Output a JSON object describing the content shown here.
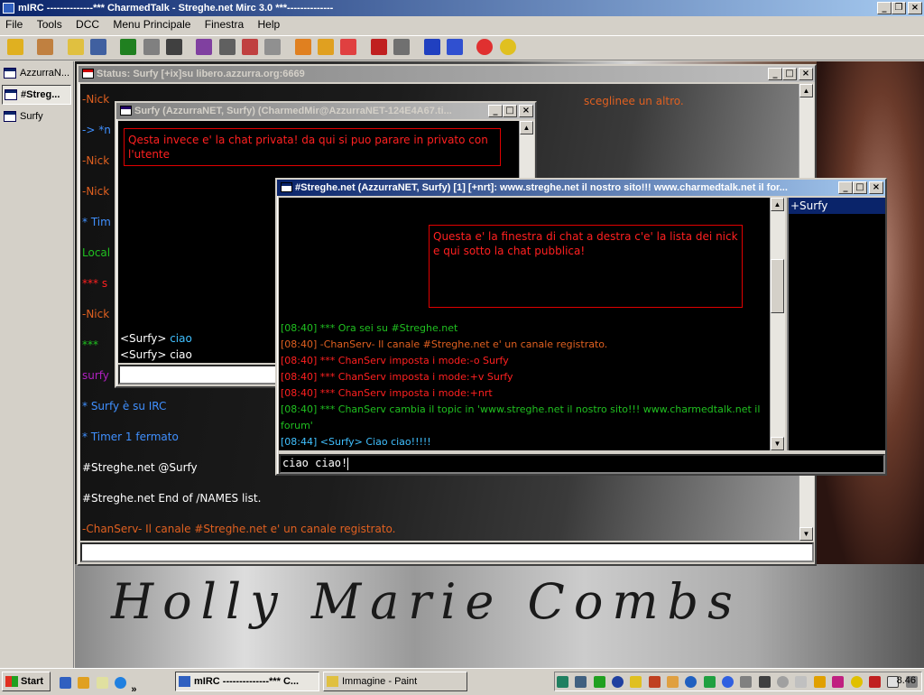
{
  "app": {
    "title": "mIRC --------------*** CharmedTalk - Streghe.net Mirc 3.0 ***--------------"
  },
  "menu": [
    "File",
    "Tools",
    "DCC",
    "Menu Principale",
    "Finestra",
    "Help"
  ],
  "switchbar": [
    {
      "label": "AzzurraN...",
      "active": false
    },
    {
      "label": "#Streg...",
      "active": true
    },
    {
      "label": "Surfy",
      "active": false
    }
  ],
  "status_window": {
    "title": "Status: Surfy [+ix]su libero.azzurra.org:6669",
    "lines": [
      {
        "text": "-Nick",
        "color": "#e06020"
      },
      {
        "text": "-> *n",
        "color": "#4090ff"
      },
      {
        "text": "-Nick",
        "color": "#e06020"
      },
      {
        "text": "-Nick",
        "color": "#e06020"
      },
      {
        "text": "* Tim",
        "color": "#4090ff"
      },
      {
        "text": "Local",
        "color": "#20c020"
      },
      {
        "text": "*** s",
        "color": "#ff2020"
      },
      {
        "text": "-Nick",
        "color": "#e06020"
      },
      {
        "text": "***",
        "color": "#20c020"
      },
      {
        "text": "surfy",
        "color": "#b020c0"
      },
      {
        "text": "* Surfy è su IRC",
        "color": "#4090ff"
      },
      {
        "text": "* Timer 1 fermato",
        "color": "#4090ff"
      },
      {
        "text": "#Streghe.net @Surfy",
        "color": "#ffffff"
      },
      {
        "text": "#Streghe.net End of /NAMES list.",
        "color": "#ffffff"
      },
      {
        "text": "-ChanServ- Il canale #Streghe.net e' un canale registrato.",
        "color": "#e06020"
      }
    ],
    "overflow_text": "-Nick ... sceglinee un altro."
  },
  "private_window": {
    "title": "Surfy (AzzurraNET, Surfy) (CharmedMir@AzzurraNET-124E4A67.ti...",
    "annotation": "Qesta invece e' la chat privata! da qui si puo parare in privato con l'utente",
    "lines": [
      {
        "nick": "<Surfy>",
        "msg": "ciao",
        "msgcolor": "#40c0ff"
      },
      {
        "nick": "<Surfy>",
        "msg": "ciao",
        "msgcolor": "#ffffff"
      }
    ]
  },
  "channel_window": {
    "title": "#Streghe.net (AzzurraNET, Surfy) [1] [+nrt]: www.streghe.net il nostro sito!!! www.charmedtalk.net il for...",
    "annotation": "Questa e' la finestra di chat a destra c'e' la lista dei nick e qui sotto la chat pubblica!",
    "lines": [
      {
        "text": "[08:40] *** Ora sei su #Streghe.net",
        "color": "#20c020"
      },
      {
        "text": "[08:40] -ChanServ- Il canale #Streghe.net e' un canale registrato.",
        "color": "#e06020"
      },
      {
        "text": "[08:40] *** ChanServ imposta i mode:-o Surfy",
        "color": "#ff2020"
      },
      {
        "text": "[08:40] *** ChanServ imposta i mode:+v Surfy",
        "color": "#ff2020"
      },
      {
        "text": "[08:40] *** ChanServ imposta i mode:+nrt",
        "color": "#ff2020"
      },
      {
        "text": "[08:40] *** ChanServ cambia il topic in 'www.streghe.net il nostro sito!!! www.charmedtalk.net il",
        "color": "#20c020"
      },
      {
        "text": "forum'",
        "color": "#20c020"
      },
      {
        "text": "[08:44] <Surfy> Ciao ciao!!!!!",
        "color": "#40c0ff"
      }
    ],
    "nicklist": [
      "+Surfy"
    ],
    "input_value": "ciao ciao!"
  },
  "background_signature": "Holly Marie Combs",
  "taskbar": {
    "start_label": "Start",
    "buttons": [
      {
        "label": "mIRC --------------*** C...",
        "pressed": true
      },
      {
        "label": "Immagine - Paint",
        "pressed": false
      }
    ],
    "clock": "8.46"
  },
  "colors": {
    "title_active": "#0a246a",
    "chat_bg": "#000000",
    "annotation_red": "#ff2020"
  }
}
